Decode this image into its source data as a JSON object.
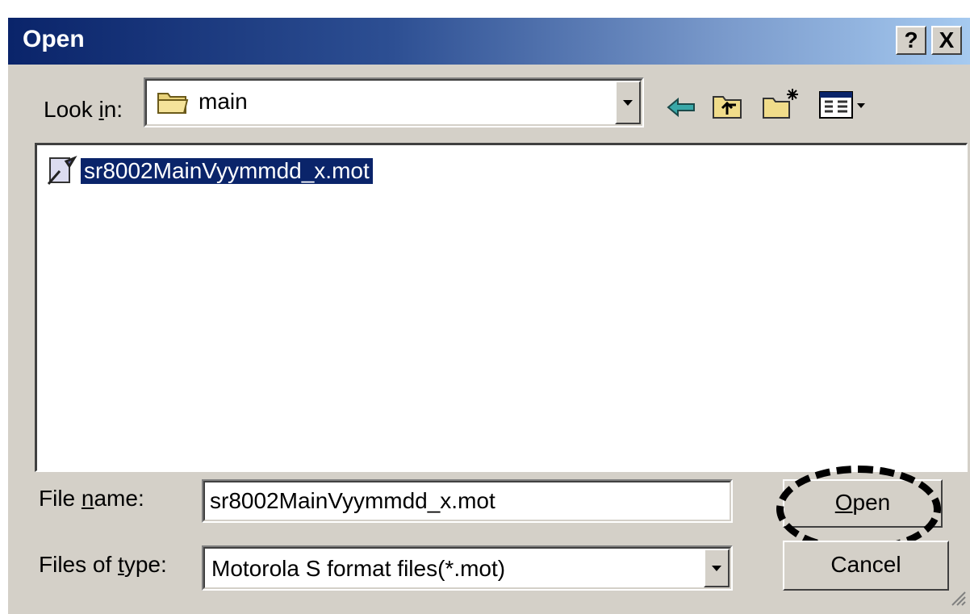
{
  "dialog": {
    "title": "Open",
    "help_button": "?",
    "close_button": "X"
  },
  "look_in": {
    "label_pre": "Look ",
    "label_accel": "i",
    "label_post": "n:",
    "value": "main",
    "folder_icon": "folder-icon"
  },
  "toolbar": {
    "icons": [
      "back-arrow-icon",
      "up-one-level-icon",
      "new-folder-icon",
      "view-menu-icon"
    ]
  },
  "file_list": {
    "items": [
      {
        "name": "sr8002MainVyymmdd_x.mot",
        "icon": "mot-file-icon",
        "selected": true
      }
    ]
  },
  "file_name": {
    "label_pre": "File ",
    "label_accel": "n",
    "label_post": "ame:",
    "value": "sr8002MainVyymmdd_x.mot"
  },
  "files_of_type": {
    "label_pre": "Files of ",
    "label_accel": "t",
    "label_post": "ype:",
    "value": "Motorola S format files(*.mot)"
  },
  "buttons": {
    "open_accel": "O",
    "open_rest": "pen",
    "cancel": "Cancel"
  },
  "colors": {
    "title_start": "#0a246a",
    "title_end": "#a6caf0",
    "selection": "#0a246a",
    "face": "#d4d0c8"
  }
}
